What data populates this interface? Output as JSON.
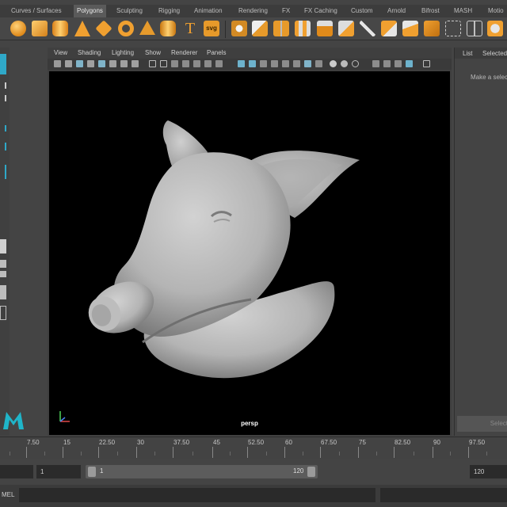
{
  "shelf": {
    "tabs": [
      "Curves / Surfaces",
      "Polygons",
      "Sculpting",
      "Rigging",
      "Animation",
      "Rendering",
      "FX",
      "FX Caching",
      "Custom",
      "Arnold",
      "Bifrost",
      "MASH",
      "Motio"
    ],
    "active_tab": "Polygons",
    "icons": [
      "sphere-icon",
      "cube-icon",
      "cylinder-icon",
      "cone-icon",
      "plane-icon",
      "torus-icon",
      "pyramid-icon",
      "pipe-icon",
      "type-text-icon",
      "svg-icon",
      "combine-icon",
      "separate-icon",
      "mirror-icon",
      "bridge-icon",
      "extrude-icon",
      "bevel-icon",
      "knife-icon",
      "multicut-icon",
      "target-weld-icon",
      "uv-unfold-icon",
      "cube-bounds-icon",
      "uv-editor-icon",
      "smooth-icon",
      "sculpt-icon"
    ],
    "type_icon_glyph": "T",
    "svg_icon_label": "svg"
  },
  "viewport_panel": {
    "menu": [
      "View",
      "Shading",
      "Lighting",
      "Show",
      "Renderer",
      "Panels"
    ],
    "camera_label": "persp",
    "background": "#000000",
    "model": "pig-head-sculpt"
  },
  "right_panel": {
    "tabs": [
      "List",
      "Selected"
    ],
    "message": "Make a select",
    "button_label": "Select"
  },
  "time_slider": {
    "ticks": [
      "7.50",
      "15",
      "22.50",
      "30",
      "37.50",
      "45",
      "52.50",
      "60",
      "67.50",
      "75",
      "82.50",
      "90",
      "97.50"
    ]
  },
  "range_slider": {
    "start_field": "",
    "range_start": "1",
    "range_inner_start": "1",
    "range_inner_end": "120",
    "range_end": "120"
  },
  "command_line": {
    "label": "MEL"
  },
  "colors": {
    "accent": "#2fa8c8",
    "shelf_orange": "#f0a030",
    "panel": "#3f3f3f",
    "viewport": "#000000"
  }
}
